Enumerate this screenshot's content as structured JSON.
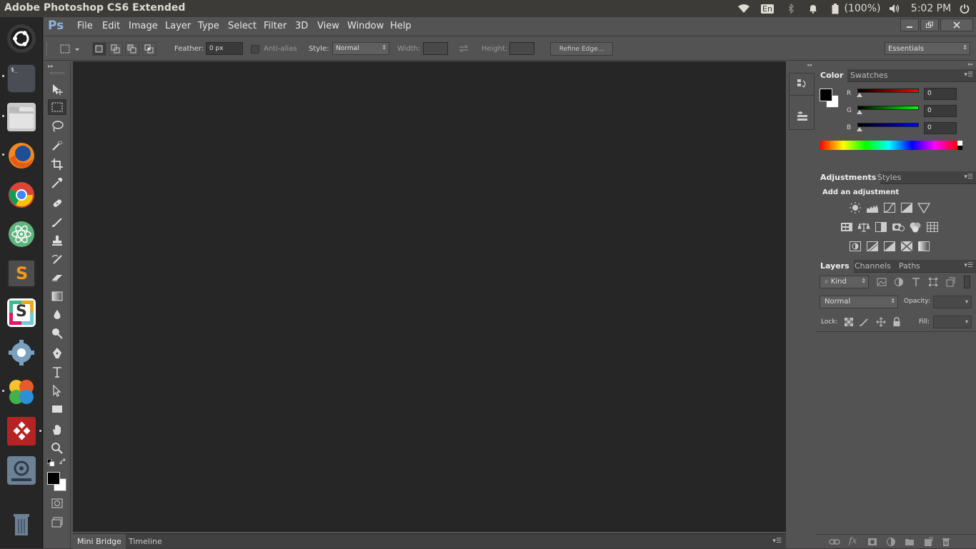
{
  "topbar": {
    "window_title": "Adobe Photoshop CS6 Extended",
    "keyboard_layout": "En",
    "battery": "(100%)",
    "clock": "5:02 PM"
  },
  "launcher": {
    "items": [
      "Ubuntu Dash",
      "Terminal",
      "Files",
      "Firefox",
      "Chrome",
      "Atom",
      "Sublime Text",
      "Slack",
      "System Settings",
      "Pinwheel App",
      "Wine App",
      "Disk App",
      "Trash"
    ],
    "terminal_prompt": "$_",
    "sublime_letter": "S",
    "slack_letter": "S"
  },
  "photoshop": {
    "logo": "Ps",
    "menu": [
      "File",
      "Edit",
      "Image",
      "Layer",
      "Type",
      "Select",
      "Filter",
      "3D",
      "View",
      "Window",
      "Help"
    ],
    "options": {
      "feather_label": "Feather:",
      "feather_value": "0 px",
      "antialias_label": "Anti-alias",
      "style_label": "Style:",
      "style_value": "Normal",
      "width_label": "Width:",
      "height_label": "Height:",
      "refine_edge": "Refine Edge...",
      "workspace": "Essentials"
    },
    "bottom_tabs": [
      "Mini Bridge",
      "Timeline"
    ],
    "color_panel": {
      "tabs": [
        "Color",
        "Swatches"
      ],
      "channels": [
        {
          "label": "R",
          "value": "0",
          "color": "#ff0000"
        },
        {
          "label": "G",
          "value": "0",
          "color": "#00ff00"
        },
        {
          "label": "B",
          "value": "0",
          "color": "#0000ff"
        }
      ]
    },
    "adjustments_panel": {
      "tabs": [
        "Adjustments",
        "Styles"
      ],
      "heading": "Add an adjustment"
    },
    "layers_panel": {
      "tabs": [
        "Layers",
        "Channels",
        "Paths"
      ],
      "filter_kind": "Kind",
      "blend_mode": "Normal",
      "opacity_label": "Opacity:",
      "lock_label": "Lock:",
      "fill_label": "Fill:"
    }
  },
  "colors": {
    "canvas": "#262626",
    "ui_gray": "#535353",
    "ps_blue": "#8bb4de"
  }
}
